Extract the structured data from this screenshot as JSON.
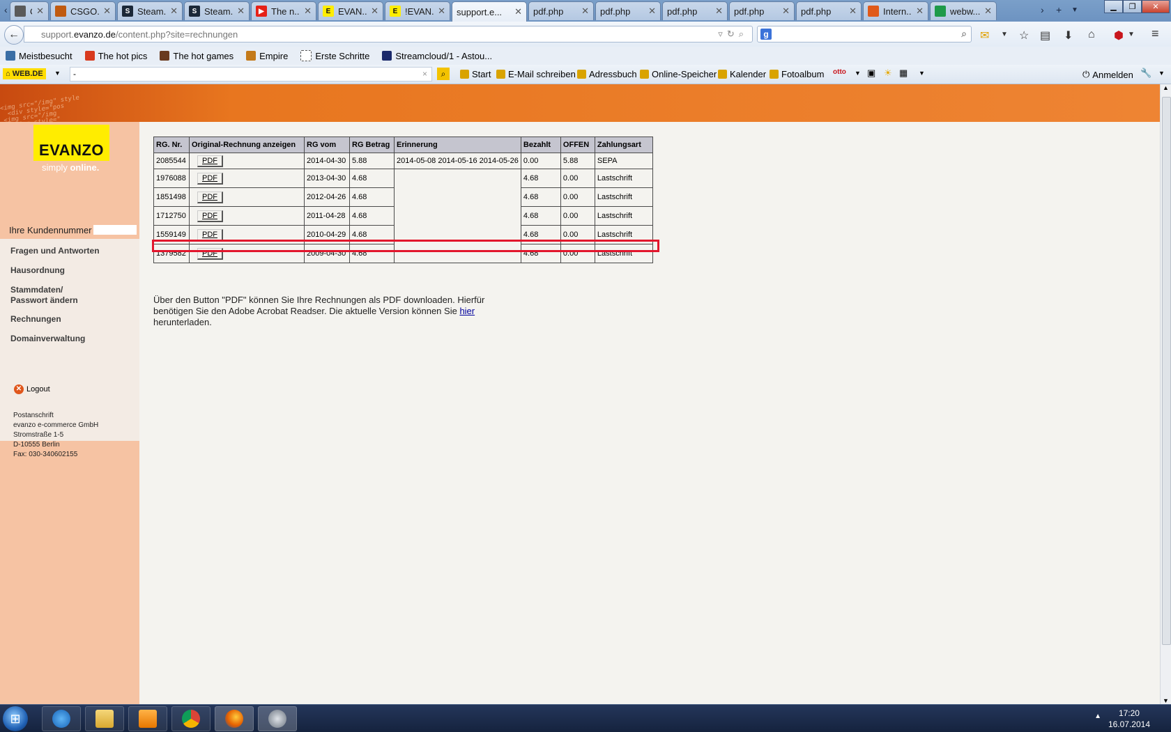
{
  "tabs": [
    {
      "label": "O...",
      "favicon_color": "#5a5a5a",
      "favicon_glyph": ""
    },
    {
      "label": "CSGO...",
      "favicon_color": "#c05a10",
      "favicon_glyph": ""
    },
    {
      "label": "Steam...",
      "favicon_color": "#1b2838",
      "favicon_glyph": "S"
    },
    {
      "label": "Steam...",
      "favicon_color": "#1b2838",
      "favicon_glyph": "S"
    },
    {
      "label": "The n...",
      "favicon_color": "#e62117",
      "favicon_glyph": "▶"
    },
    {
      "label": "EVAN...",
      "favicon_color": "#ffed00",
      "favicon_glyph": "E"
    },
    {
      "label": "!EVAN...",
      "favicon_color": "#ffed00",
      "favicon_glyph": "E"
    },
    {
      "label": "support.e...",
      "favicon_color": "",
      "favicon_glyph": "",
      "active": true
    },
    {
      "label": "pdf.php",
      "favicon_color": "",
      "favicon_glyph": ""
    },
    {
      "label": "pdf.php",
      "favicon_color": "",
      "favicon_glyph": ""
    },
    {
      "label": "pdf.php",
      "favicon_color": "",
      "favicon_glyph": ""
    },
    {
      "label": "pdf.php",
      "favicon_color": "",
      "favicon_glyph": ""
    },
    {
      "label": "pdf.php",
      "favicon_color": "",
      "favicon_glyph": ""
    },
    {
      "label": "Intern...",
      "favicon_color": "#e05a1a",
      "favicon_glyph": ""
    },
    {
      "label": "webw...",
      "favicon_color": "#1e9a4a",
      "favicon_glyph": ""
    }
  ],
  "url": {
    "domain": "support.evanzo.de",
    "prefix": "support.",
    "host": "evanzo.de",
    "path": "/content.php?site=rechnungen"
  },
  "bookmarks": [
    {
      "label": "Meistbesucht",
      "icon": "bookmark-icon",
      "color": "#3a6ea5"
    },
    {
      "label": "The hot pics",
      "icon": "pin-icon",
      "color": "#d83a1e"
    },
    {
      "label": "The hot games",
      "icon": "game-icon",
      "color": "#6a3a1e"
    },
    {
      "label": "Empire",
      "icon": "empire-icon",
      "color": "#c47a1a"
    },
    {
      "label": "Erste Schritte",
      "icon": "page-icon",
      "color": "#ffffff"
    },
    {
      "label": "Streamcloud/1 - Astou...",
      "icon": "bs-icon",
      "color": "#1b2a6b"
    }
  ],
  "webde": {
    "logo": "WEB.DE",
    "search_value": "-",
    "links": [
      "Start",
      "E-Mail schreiben",
      "Adressbuch",
      "Online-Speicher",
      "Kalender",
      "Fotoalbum"
    ],
    "login": "Anmelden"
  },
  "sidebar": {
    "logo": "EVANZO",
    "tagline_a": "simply ",
    "tagline_b": "online.",
    "customer_label": "Ihre Kundennummer",
    "menu": [
      "Fragen und Antworten",
      "Hausordnung",
      "Stammdaten/",
      "Passwort ändern",
      "Rechnungen",
      "Domainverwaltung"
    ],
    "logout": "Logout",
    "address": [
      "Postanschrift",
      "evanzo e-commerce GmbH",
      "Stromstraße 1-5",
      "D-10555 Berlin",
      "Fax: 030-340602155"
    ]
  },
  "invoices": {
    "headers": [
      "RG. Nr.",
      "Original-Rechnung anzeigen",
      "RG vom",
      "RG Betrag",
      "Erinnerung",
      "Bezahlt",
      "OFFEN",
      "Zahlungsart"
    ],
    "pdf_label": "PDF",
    "rows": [
      {
        "nr": "2085544",
        "date": "2014-04-30",
        "amount": "5.88",
        "reminder": "2014-05-08 2014-05-16 2014-05-26",
        "paid": "0.00",
        "open": "5.88",
        "method": "SEPA"
      },
      {
        "nr": "1976088",
        "date": "2013-04-30",
        "amount": "4.68",
        "reminder": "",
        "paid": "4.68",
        "open": "0.00",
        "method": "Lastschrift"
      },
      {
        "nr": "1851498",
        "date": "2012-04-26",
        "amount": "4.68",
        "reminder": "",
        "paid": "4.68",
        "open": "0.00",
        "method": "Lastschrift"
      },
      {
        "nr": "1712750",
        "date": "2011-04-28",
        "amount": "4.68",
        "reminder": "",
        "paid": "4.68",
        "open": "0.00",
        "method": "Lastschrift"
      },
      {
        "nr": "1559149",
        "date": "2010-04-29",
        "amount": "4.68",
        "reminder": "",
        "paid": "4.68",
        "open": "0.00",
        "method": "Lastschrift"
      },
      {
        "nr": "1379582",
        "date": "2009-04-30",
        "amount": "4.68",
        "reminder": "",
        "paid": "4.68",
        "open": "0.00",
        "method": "Lastschrift"
      }
    ]
  },
  "info": {
    "text_before": "Über den Button \"PDF\" können Sie Ihre Rechnungen als PDF downloaden. Hierfür benötigen Sie den Adobe Acrobat Readser. Die aktuelle Version können Sie ",
    "link": "hier",
    "text_after": " herunterladen."
  },
  "clock": {
    "time": "17:20",
    "date": "16.07.2014"
  },
  "colors": {
    "accent_orange": "#ee8433",
    "sidebar": "#f6c3a3",
    "highlight": "#e2162c",
    "logo_yellow": "#ffed00"
  }
}
